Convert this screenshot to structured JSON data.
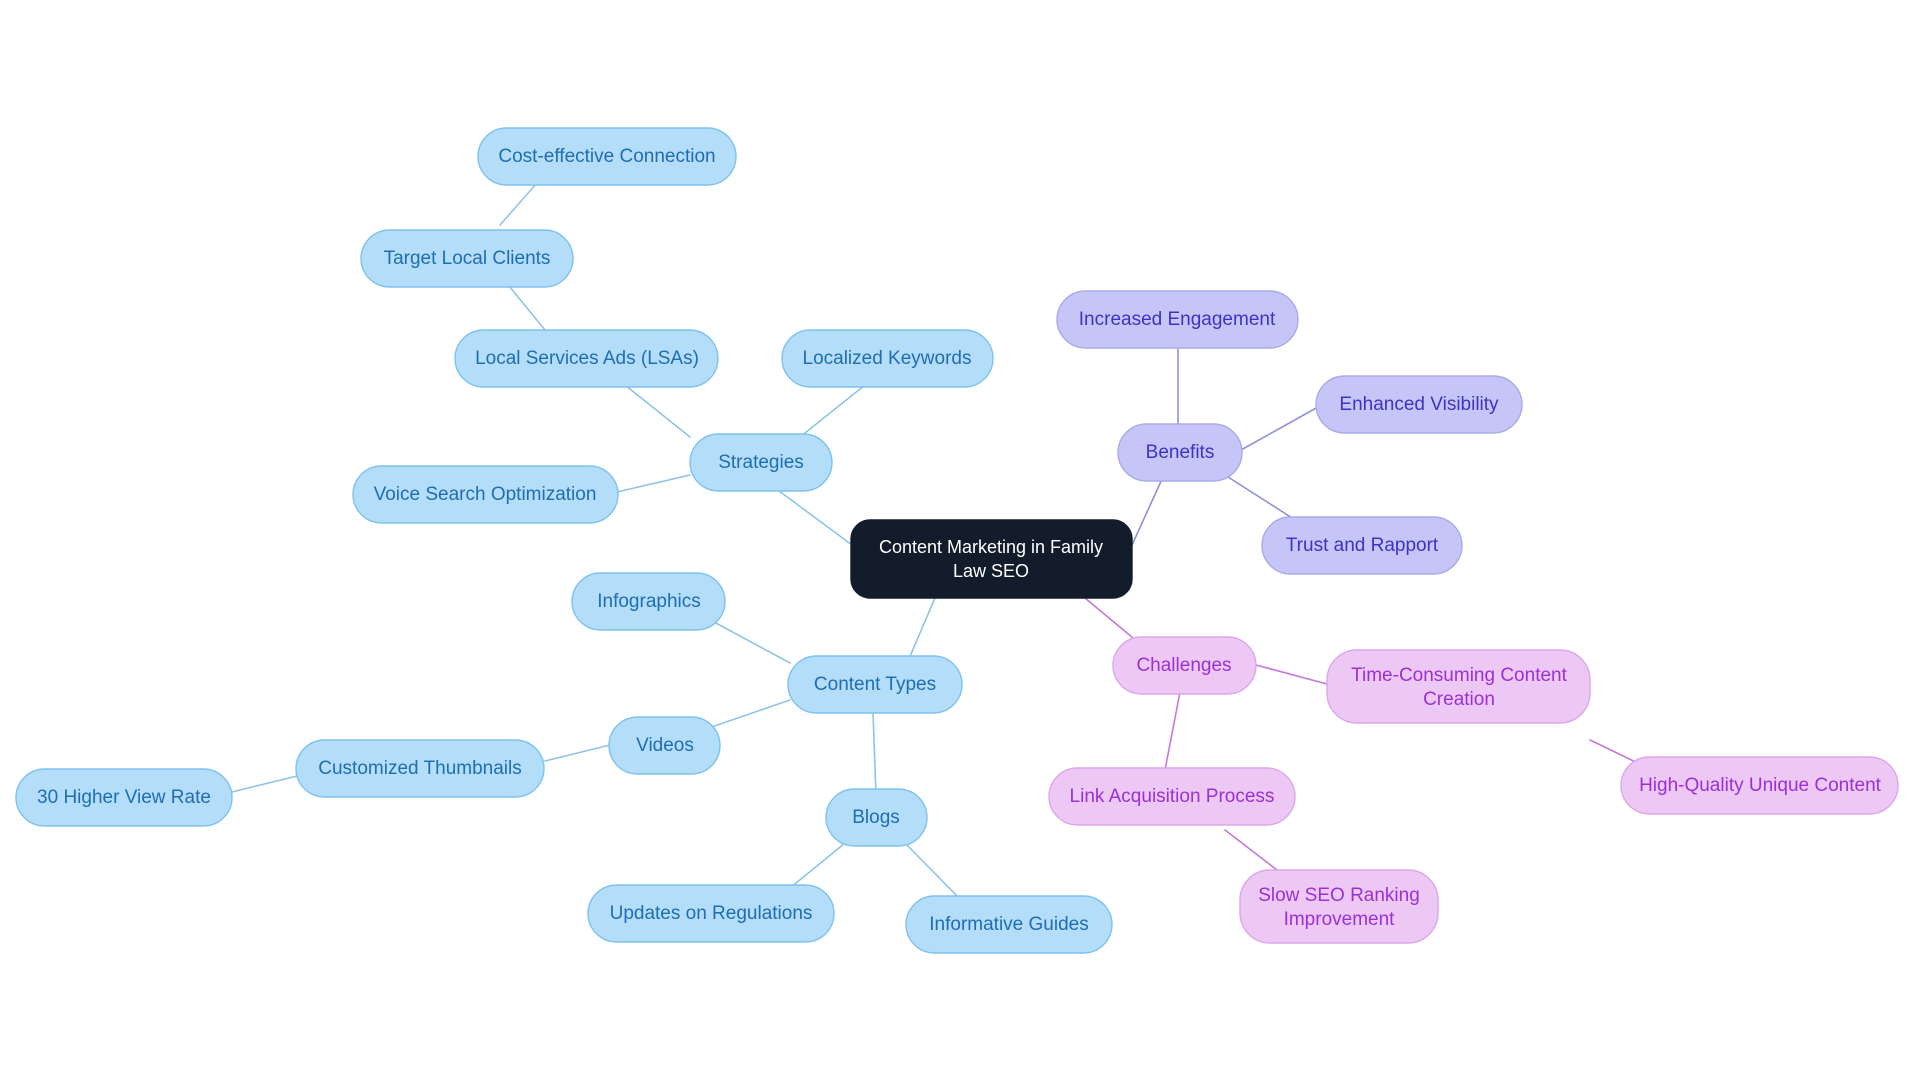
{
  "diagram": {
    "type": "mindmap",
    "title": "Content Marketing in Family Law SEO",
    "background": "#ffffff"
  },
  "palette": {
    "root_fill": "#131c2b",
    "root_text": "#ffffff",
    "blue_fill": "#b3ddf8",
    "blue_border": "#7ec2ee",
    "blue_text": "#1f6eb4",
    "blue_edge": "#8ec4e8",
    "purple_fill": "#c5c6f7",
    "purple_border": "#a9abe8",
    "purple_text": "#3b34c4",
    "purple_edge": "#8f91d8",
    "pink_fill": "#edc8f5",
    "pink_border": "#dda6ec",
    "pink_text": "#9b30d9",
    "pink_edge": "#c478dc"
  },
  "nodes": {
    "root": {
      "label": "Content Marketing in Family Law SEO",
      "line1": "Content Marketing in Family",
      "line2": "Law SEO"
    },
    "strategies": {
      "label": "Strategies"
    },
    "cost_effective": {
      "label": "Cost-effective Connection"
    },
    "target_local": {
      "label": "Target Local Clients"
    },
    "lsa": {
      "label": "Local Services Ads (LSAs)"
    },
    "localized_keywords": {
      "label": "Localized Keywords"
    },
    "voice_search": {
      "label": "Voice Search Optimization"
    },
    "benefits": {
      "label": "Benefits"
    },
    "increased_engagement": {
      "label": "Increased Engagement"
    },
    "enhanced_visibility": {
      "label": "Enhanced Visibility"
    },
    "trust_rapport": {
      "label": "Trust and Rapport"
    },
    "challenges": {
      "label": "Challenges"
    },
    "time_consuming": {
      "label": "Time-Consuming Content Creation",
      "line1": "Time-Consuming Content",
      "line2": "Creation"
    },
    "high_quality": {
      "label": "High-Quality Unique Content"
    },
    "link_acquisition": {
      "label": "Link Acquisition Process"
    },
    "slow_seo": {
      "label": "Slow SEO Ranking Improvement",
      "line1": "Slow SEO Ranking",
      "line2": "Improvement"
    },
    "content_types": {
      "label": "Content Types"
    },
    "infographics": {
      "label": "Infographics"
    },
    "videos": {
      "label": "Videos"
    },
    "customized_thumbnails": {
      "label": "Customized Thumbnails"
    },
    "view_rate": {
      "label": "30 Higher View Rate"
    },
    "blogs": {
      "label": "Blogs"
    },
    "updates_regulations": {
      "label": "Updates on Regulations"
    },
    "informative_guides": {
      "label": "Informative Guides"
    }
  },
  "structure": {
    "branches": [
      {
        "key": "strategies",
        "color": "blue",
        "children": [
          "localized_keywords",
          "lsa",
          "voice_search"
        ]
      },
      {
        "key": "benefits",
        "color": "purple",
        "children": [
          "increased_engagement",
          "enhanced_visibility",
          "trust_rapport"
        ]
      },
      {
        "key": "challenges",
        "color": "pink",
        "children": [
          "time_consuming",
          "link_acquisition"
        ]
      },
      {
        "key": "content_types",
        "color": "blue",
        "children": [
          "infographics",
          "videos",
          "blogs"
        ]
      }
    ]
  }
}
